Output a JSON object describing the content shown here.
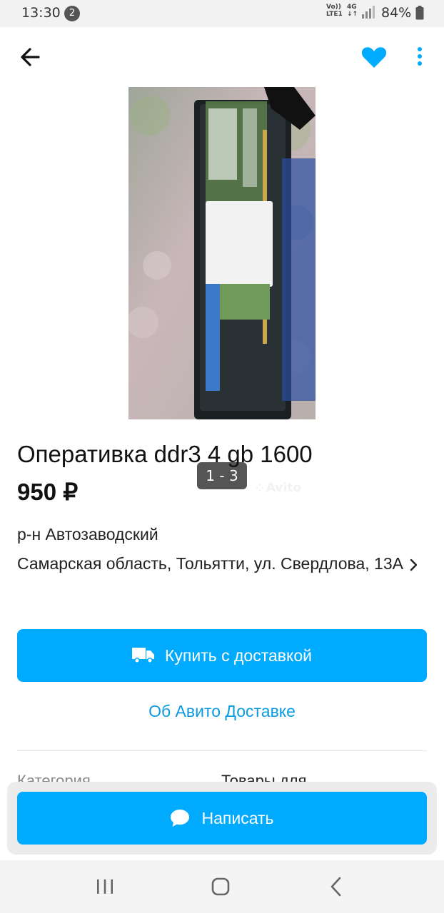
{
  "status_bar": {
    "time": "13:30",
    "notification_count": "2",
    "volte_line1": "Vo))",
    "volte_line2": "LTE1",
    "network": "4G",
    "battery": "84%"
  },
  "listing": {
    "title": "Оперативка ddr3 4 gb 1600",
    "price": "950 ₽",
    "district": "р-н Автозаводский",
    "address": "Самарская область, Тольятти, ул. Свердлова, 13А",
    "photo_counter": "1 - 3",
    "watermark": "Avito"
  },
  "actions": {
    "buy_label": "Купить с доставкой",
    "delivery_link": "Об Авито Доставке",
    "write_label": "Написать"
  },
  "params": {
    "label": "Категория",
    "value": "Товары для"
  },
  "colors": {
    "accent": "#00aaff",
    "link": "#0a9be0"
  },
  "icons": [
    "arrow-back-icon",
    "heart-icon",
    "more-vertical-icon",
    "truck-icon",
    "chat-bubble-icon",
    "chevron-right-icon"
  ]
}
